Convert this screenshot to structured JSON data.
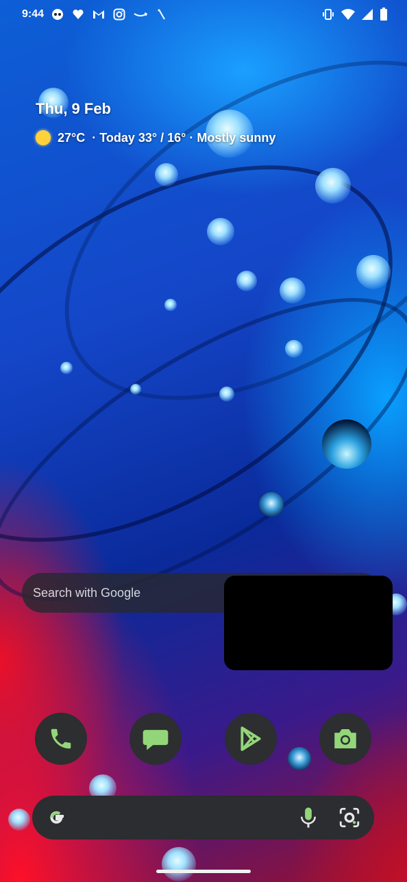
{
  "status_bar": {
    "time": "9:44",
    "left_icons": [
      "chrome-remote-icon",
      "heart-icon",
      "gmail-icon",
      "instagram-icon",
      "amazon-icon",
      "slash-icon"
    ],
    "right_icons": [
      "vibrate-icon",
      "wifi-icon",
      "signal-icon",
      "battery-icon"
    ]
  },
  "glance": {
    "date": "Thu, 9 Feb",
    "temperature": "27°C",
    "forecast": "· Today 33° / 16° · Mostly sunny"
  },
  "search_widget": {
    "placeholder": "Search with Google"
  },
  "dock": {
    "apps": [
      {
        "name": "Phone",
        "icon": "phone-icon"
      },
      {
        "name": "Messages",
        "icon": "messages-icon"
      },
      {
        "name": "Play Store",
        "icon": "play-store-icon"
      },
      {
        "name": "Camera",
        "icon": "camera-icon"
      }
    ]
  },
  "google_bar": {
    "icons": [
      "google-g-icon",
      "microphone-icon",
      "lens-icon"
    ]
  },
  "colors": {
    "accent_green": "#93d67a",
    "dock_bg": "#2c2e30"
  }
}
